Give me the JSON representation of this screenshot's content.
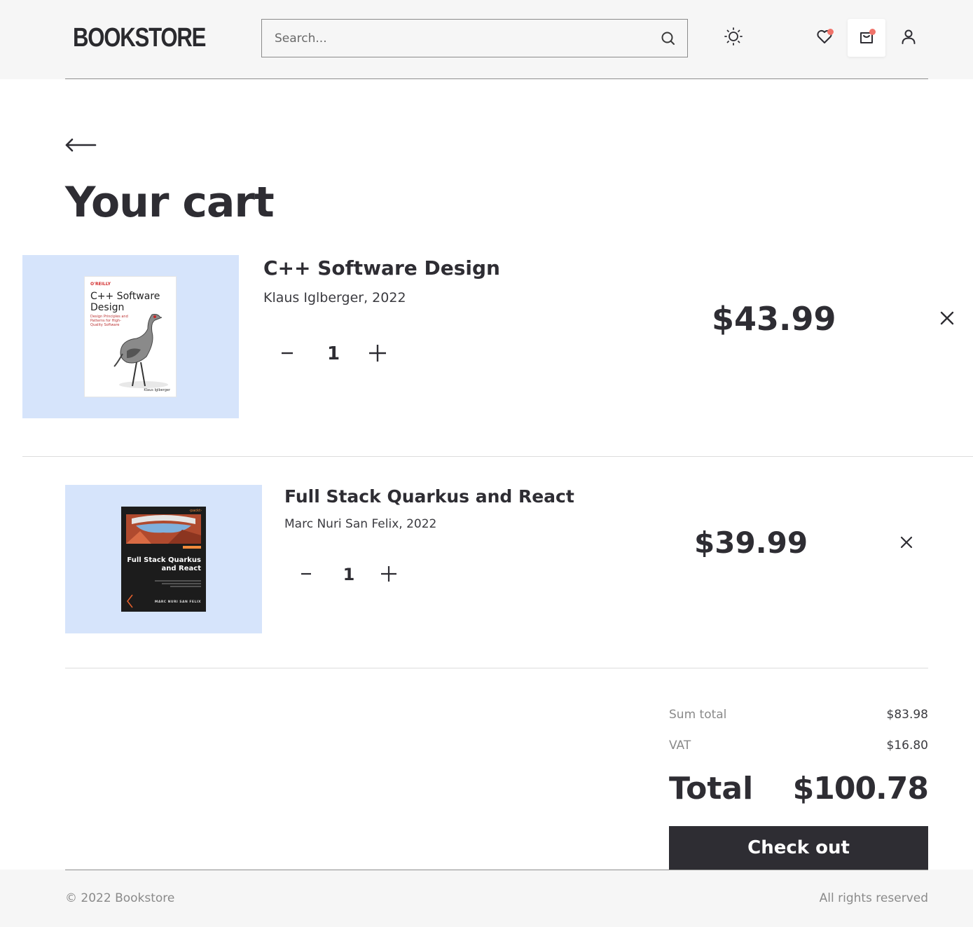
{
  "header": {
    "logo": "BOOKSTORE",
    "search_placeholder": "Search...",
    "icons": [
      "search-icon",
      "sun-icon",
      "heart-icon",
      "shopping-bag-icon",
      "user-icon"
    ],
    "badge_color": "#f0736a"
  },
  "main": {
    "title": "Your cart",
    "back_icon": "arrow-left-icon",
    "items": [
      {
        "title": "C++ Software Design",
        "meta": "Klaus Iglberger, 2022",
        "quantity": "1",
        "price": "$43.99",
        "cover": {
          "publisher": "O'REILLY",
          "title_line1": "C++ Software",
          "title_line2": "Design",
          "subtitle": "Design Principles and Patterns for High-Quality Software",
          "author": "Klaus Iglberger"
        }
      },
      {
        "title": "Full Stack Quarkus and React",
        "meta": "Marc Nuri San Felix, 2022",
        "quantity": "1",
        "price": "$39.99",
        "cover": {
          "publisher": "‹packt›",
          "title_line1": "Full Stack Quarkus",
          "title_line2": "and React",
          "author": "MARC NURI SAN FELIX"
        }
      }
    ]
  },
  "summary": {
    "sum_total_label": "Sum total",
    "sum_total_value": "$83.98",
    "vat_label": "VAT",
    "vat_value": "$16.80",
    "total_label": "Total",
    "total_value": "$100.78",
    "checkout_label": "Check out"
  },
  "footer": {
    "copyright": "© 2022 Bookstore",
    "rights": "All rights reserved"
  },
  "colors": {
    "primary_dark": "#2e2d33",
    "cover_background": "#d6e4fb",
    "header_background": "#f6f6f6",
    "badge": "#f0736a"
  }
}
